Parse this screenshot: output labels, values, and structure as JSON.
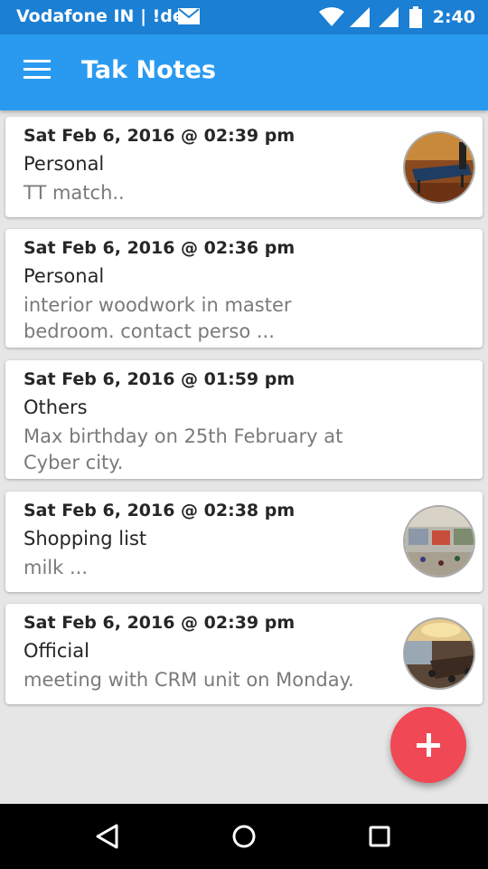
{
  "status_bar": {
    "carrier": "Vodafone IN | !dea",
    "time": "2:40",
    "icons": [
      "mail-icon",
      "wifi-icon",
      "signal-icon",
      "signal-icon-2",
      "battery-icon"
    ]
  },
  "app_bar": {
    "title": "Tak Notes",
    "menu_icon": "hamburger-menu-icon"
  },
  "notes": [
    {
      "date": "Sat Feb 6, 2016 @ 02:39 pm",
      "category": "Personal",
      "text": "TT match..",
      "has_image": true,
      "image": "table-tennis-photo"
    },
    {
      "date": "Sat Feb 6, 2016 @ 02:36 pm",
      "category": "Personal",
      "text": "interior woodwork in master bedroom. contact perso ...",
      "has_image": false
    },
    {
      "date": "Sat Feb 6, 2016 @ 01:59 pm",
      "category": "Others",
      "text": "Max birthday on 25th February at Cyber city.",
      "has_image": false
    },
    {
      "date": "Sat Feb 6, 2016 @ 02:38 pm",
      "category": "Shopping list",
      "text": "milk ...",
      "has_image": true,
      "image": "mall-photo"
    },
    {
      "date": "Sat Feb 6, 2016 @ 02:39 pm",
      "category": "Official",
      "text": "meeting with CRM unit on Monday.",
      "has_image": true,
      "image": "meeting-room-photo"
    }
  ],
  "fab": {
    "icon": "plus-icon"
  },
  "nav_bar": {
    "icons": [
      "back-icon",
      "home-icon",
      "recents-icon"
    ]
  },
  "colors": {
    "status_bar": "#1b7fd3",
    "app_bar": "#2a9af0",
    "fab": "#f04855",
    "background": "#e6e6e6"
  }
}
